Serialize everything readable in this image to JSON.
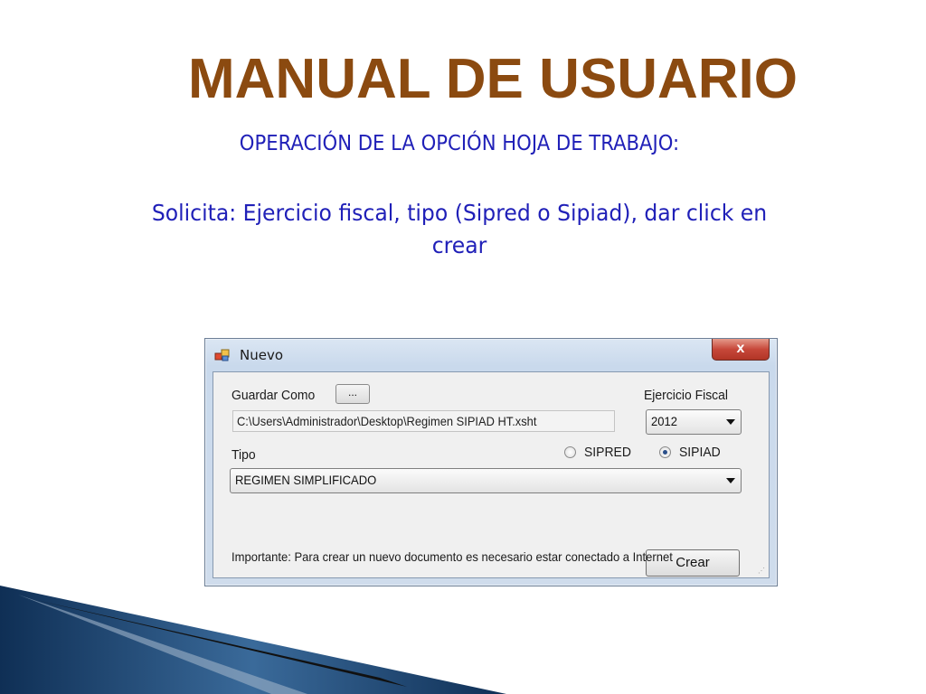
{
  "slide": {
    "title": "MANUAL DE USUARIO",
    "subtitle": "OPERACIÓN DE LA OPCIÓN HOJA DE TRABAJO:",
    "body_line1": "Solicita: Ejercicio fiscal, tipo (Sipred o Sipiad), dar click en",
    "body_line2": "crear"
  },
  "dialog": {
    "title": "Nuevo",
    "close_label": "x",
    "save_as_label": "Guardar Como",
    "browse_label": "...",
    "path_value": "C:\\Users\\Administrador\\Desktop\\Regimen SIPIAD HT.xsht",
    "fiscal_year_label": "Ejercicio Fiscal",
    "fiscal_year_value": "2012",
    "type_label": "Tipo",
    "radio_sipred": "SIPRED",
    "radio_sipiad": "SIPIAD",
    "selected_type": "SIPIAD",
    "regime_value": "REGIMEN  SIMPLIFICADO",
    "create_label": "Crear",
    "note": "Importante: Para crear un nuevo documento es necesario estar conectado a Internet"
  },
  "colors": {
    "title": "#8b4a10",
    "text_blue": "#2020b8",
    "decor_dark": "#0f2f55",
    "decor_mid": "#3a6a9a"
  }
}
